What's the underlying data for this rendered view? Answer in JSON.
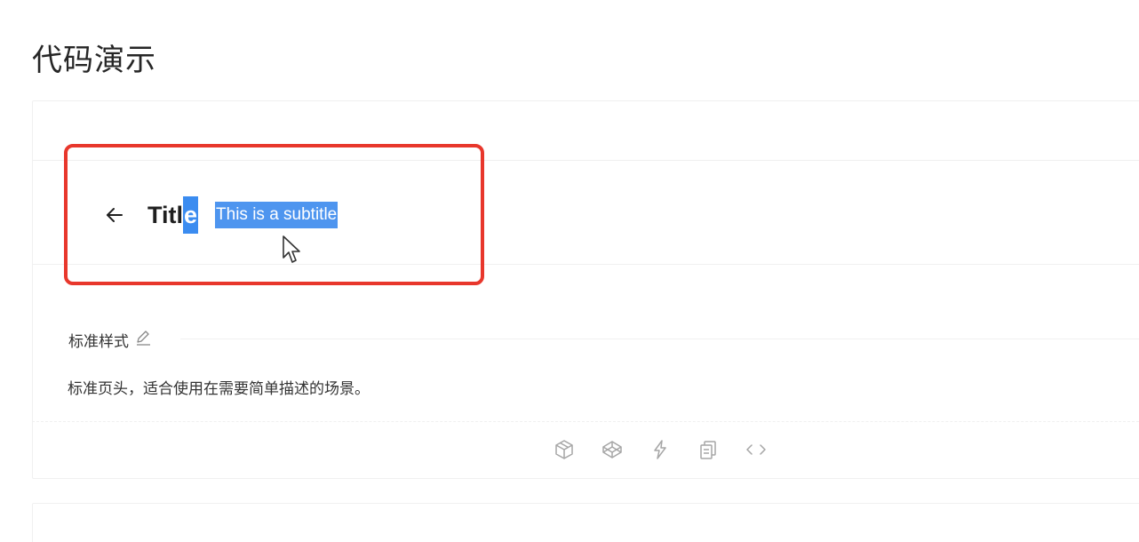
{
  "section": {
    "title": "代码演示"
  },
  "demo": {
    "header": {
      "title_plain": "Titl",
      "title_selected": "e",
      "subtitle": "This is a subtitle"
    },
    "meta": {
      "title": "标准样式",
      "description": "标准页头，适合使用在需要简单描述的场景。"
    },
    "actions": [
      {
        "icon": "codesandbox-icon"
      },
      {
        "icon": "codepen-icon"
      },
      {
        "icon": "stackblitz-icon"
      },
      {
        "icon": "copy-icon"
      },
      {
        "icon": "expand-code-icon"
      }
    ]
  },
  "colors": {
    "highlight_border": "#e8372c",
    "selection": "#3b8cf0"
  }
}
